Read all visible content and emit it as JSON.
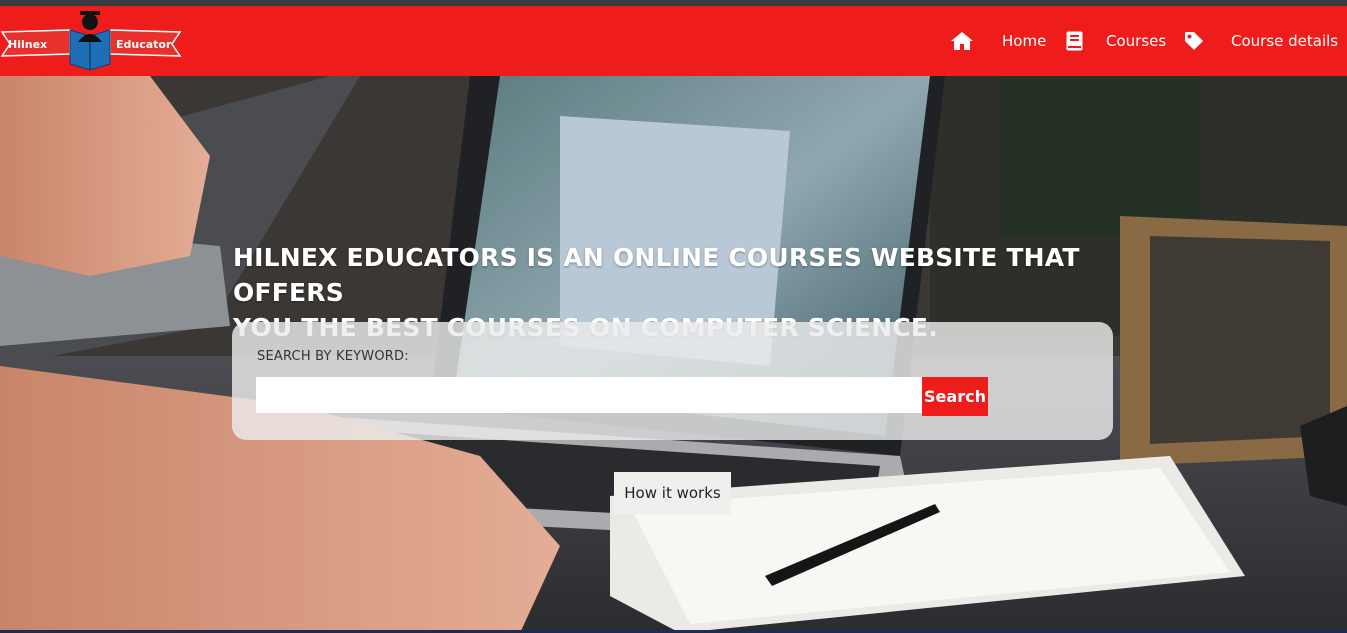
{
  "brand": {
    "left_word": "Hilnex",
    "right_word": "Educator",
    "colors": {
      "ribbon": "#ef1c1c",
      "book": "#1e6fb8",
      "figure": "#111111"
    }
  },
  "nav": {
    "bar_color": "#ef1c1c",
    "items": [
      {
        "icon": "home-icon",
        "label": "Home"
      },
      {
        "icon": "book-icon",
        "label": "Courses"
      },
      {
        "icon": "tag-icon",
        "label": "Course details"
      }
    ]
  },
  "hero": {
    "headline_line1": "HILNEX EDUCATORS IS AN ONLINE COURSES WEBSITE THAT OFFERS",
    "headline_line2": "YOU THE BEST COURSES ON COMPUTER SCIENCE.",
    "search": {
      "label": "SEARCH BY KEYWORD:",
      "value": "",
      "placeholder": "",
      "button_label": "Search"
    },
    "how_it_works_label": "How it works"
  }
}
